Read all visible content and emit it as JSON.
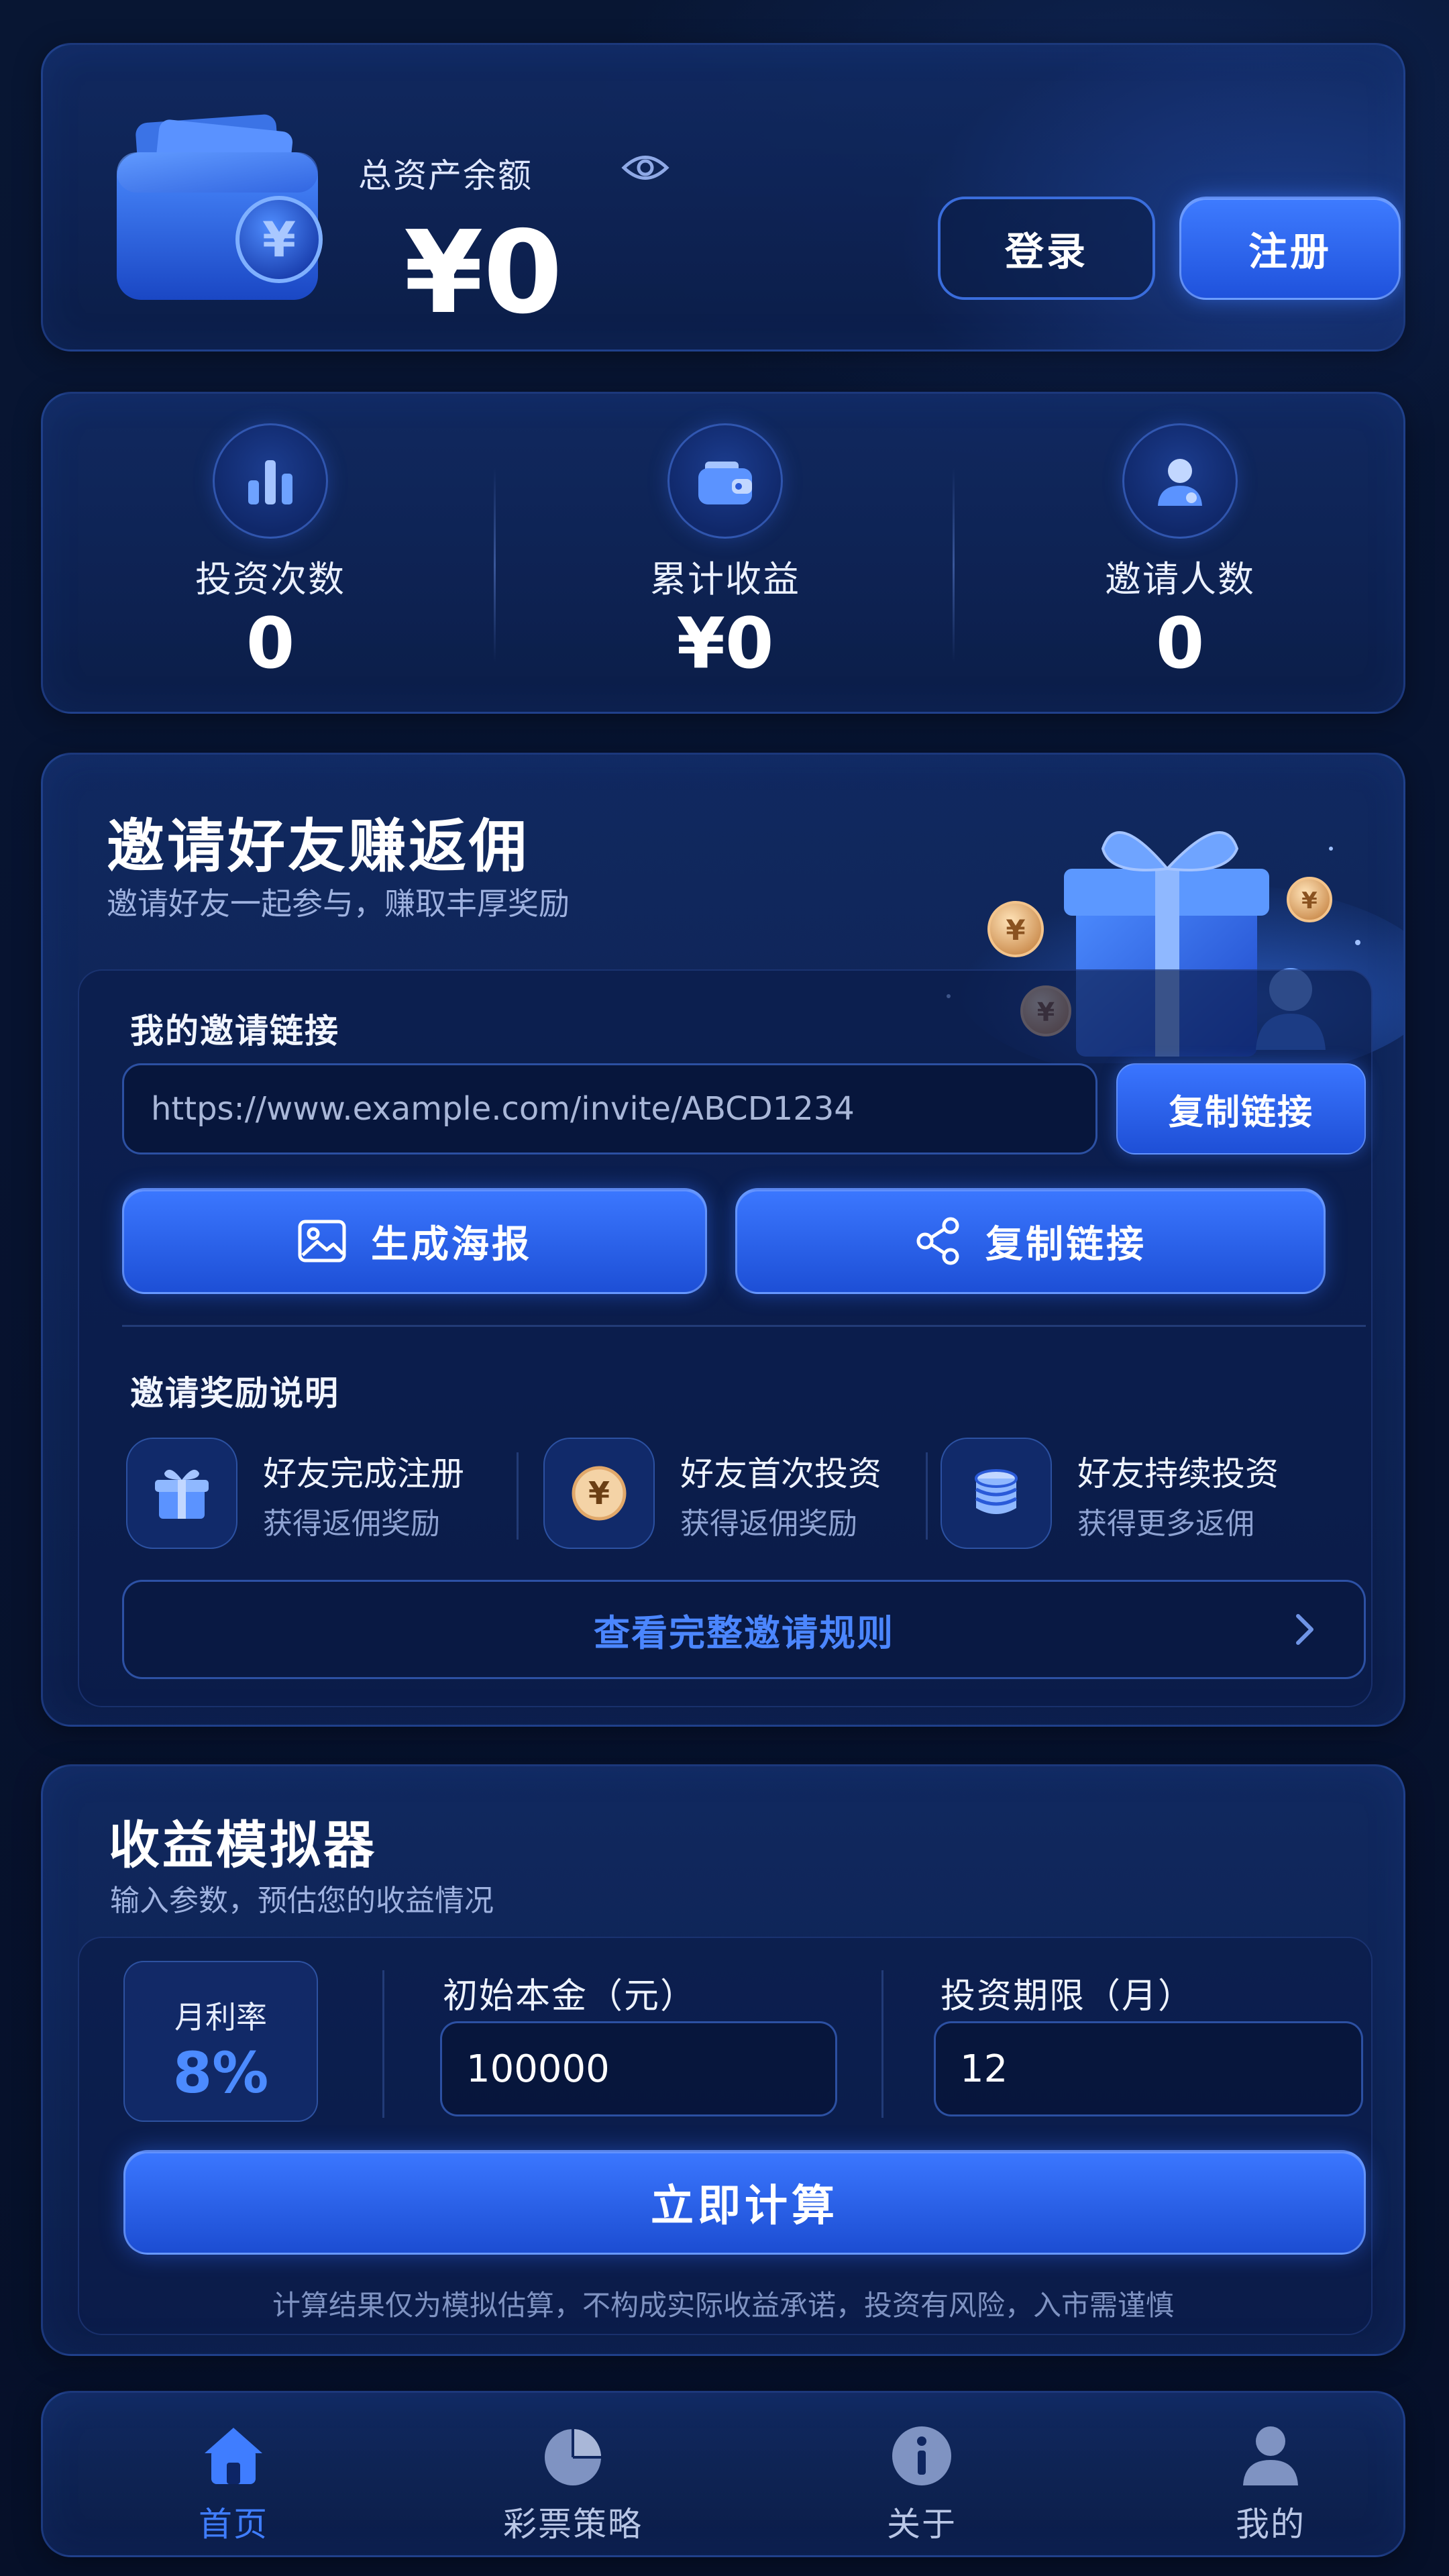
{
  "balance": {
    "label": "总资产余额",
    "amount": "¥0",
    "login_label": "登录",
    "register_label": "注册"
  },
  "stats": [
    {
      "label": "投资次数",
      "value": "0",
      "icon": "bar-chart-icon"
    },
    {
      "label": "累计收益",
      "value": "¥0",
      "icon": "wallet-icon"
    },
    {
      "label": "邀请人数",
      "value": "0",
      "icon": "user-icon"
    }
  ],
  "invite": {
    "title": "邀请好友赚返佣",
    "subtitle": "邀请好友一起参与，赚取丰厚奖励",
    "link_label": "我的邀请链接",
    "link_value": "https://www.example.com/invite/ABCD1234",
    "copy_label": "复制链接",
    "poster_label": "生成海报",
    "copy_wide_label": "复制链接",
    "rewards_label": "邀请奖励说明",
    "rewards": [
      {
        "title": "好友完成注册",
        "desc": "获得返佣奖励",
        "icon": "gift-icon"
      },
      {
        "title": "好友首次投资",
        "desc": "获得返佣奖励",
        "icon": "yen-coin-icon"
      },
      {
        "title": "好友持续投资",
        "desc": "获得更多返佣",
        "icon": "coin-stack-icon"
      }
    ],
    "rules_label": "查看完整邀请规则"
  },
  "simulator": {
    "title": "收益模拟器",
    "subtitle": "输入参数，预估您的收益情况",
    "rate_label": "月利率",
    "rate_value": "8%",
    "principal_label": "初始本金（元）",
    "principal_value": "100000",
    "period_label": "投资期限（月）",
    "period_value": "12",
    "calc_label": "立即计算",
    "disclaimer": "计算结果仅为模拟估算，不构成实际收益承诺，投资有风险，入市需谨慎"
  },
  "nav": [
    {
      "label": "首页",
      "icon": "home-icon",
      "active": true
    },
    {
      "label": "彩票策略",
      "icon": "pie-chart-icon",
      "active": false
    },
    {
      "label": "关于",
      "icon": "info-icon",
      "active": false
    },
    {
      "label": "我的",
      "icon": "profile-icon",
      "active": false
    }
  ],
  "colors": {
    "background": "#061029",
    "card": "#122b64",
    "accent": "#2f6bff",
    "accent_text": "#4b86ff",
    "muted_text": "#9fb2e0"
  }
}
